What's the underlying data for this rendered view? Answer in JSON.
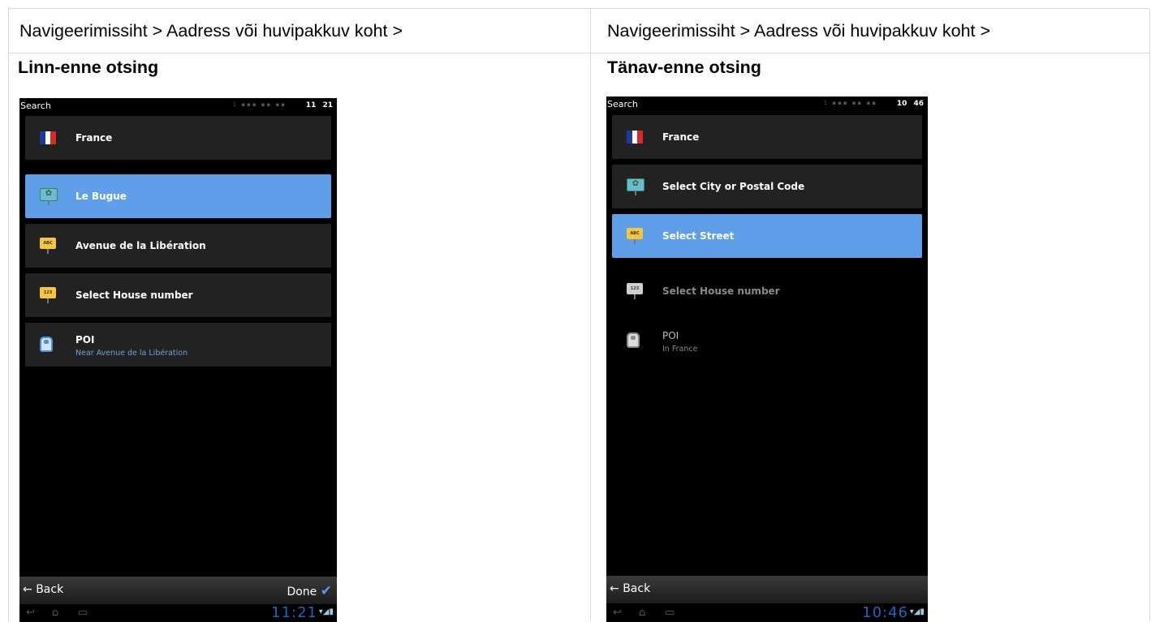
{
  "left": {
    "breadcrumb": "Navigeerimissiht > Aadress või huvipakkuv koht >",
    "heading": "Linn-enne otsing",
    "phone": {
      "status_title": "Search",
      "status_dim": "1 ▪▪▪ ▪▪ ▪▪",
      "status_time": "11 21",
      "items": [
        {
          "label": "France",
          "icon": "france-flag-icon"
        },
        {
          "label": "Le Bugue",
          "icon": "city-sign-icon",
          "icon_text": "✿"
        },
        {
          "label": "Avenue de la Libération",
          "icon": "street-sign-icon",
          "icon_text": "ABC"
        },
        {
          "label": "Select House number",
          "icon": "house-number-sign-icon",
          "icon_text": "123"
        },
        {
          "label": "POI",
          "sub": "Near Avenue de la Libération",
          "icon": "poi-icon"
        }
      ],
      "back_label": "Back",
      "done_label": "Done",
      "system_time": "11:21"
    }
  },
  "right": {
    "breadcrumb": "Navigeerimissiht > Aadress või huvipakkuv koht >",
    "heading": "Tänav-enne otsing",
    "phone": {
      "status_title": "Search",
      "status_dim": "1 ▪▪▪ ▪▪ ▪▪",
      "status_time": "10 46",
      "items": [
        {
          "label": "France",
          "icon": "france-flag-icon"
        },
        {
          "label": "Select City or Postal Code",
          "icon": "city-sign-icon",
          "icon_text": "✿"
        },
        {
          "label": "Select Street",
          "icon": "street-sign-icon",
          "icon_text": "ABC"
        },
        {
          "label": "Select House number",
          "icon": "house-number-sign-icon",
          "icon_text": "123"
        },
        {
          "label": "POI",
          "sub": "In France",
          "icon": "poi-icon"
        }
      ],
      "back_label": "Back",
      "system_time": "10:46"
    }
  },
  "colors": {
    "selected_row": "#5f9ee9",
    "row_bg": "#222222",
    "sub_text": "#6aa2de",
    "check": "#4f9bef",
    "system_clock": "#1f67b6"
  },
  "icons": {
    "back": "←",
    "done_check": "✔",
    "nav_back": "↩",
    "nav_home": "⌂",
    "nav_recent": "▭",
    "system_status": "▾◢▮"
  }
}
